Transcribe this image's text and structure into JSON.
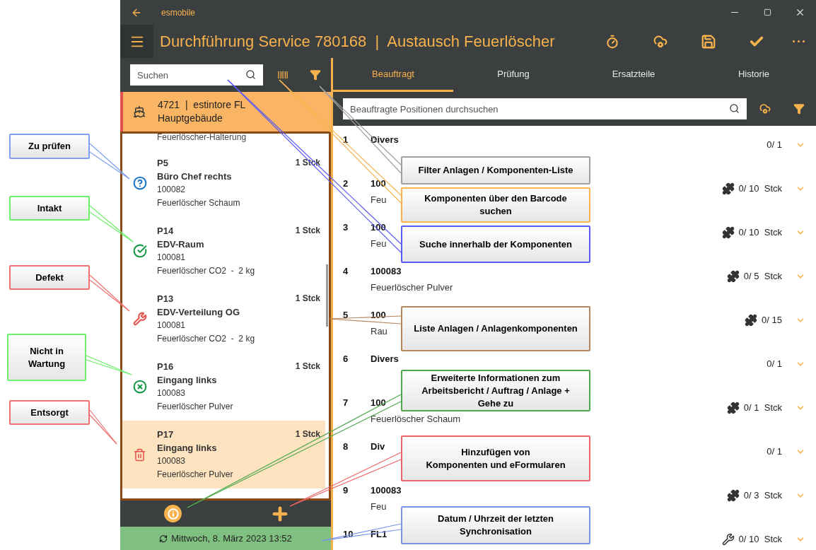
{
  "window": {
    "title": "esmobile"
  },
  "header": {
    "title": "Durchführung Service 780168  |  Austausch Feuerlöscher"
  },
  "left_panel": {
    "search": {
      "placeholder": "Suchen"
    },
    "selected_object": {
      "title": "4721  |  estintore FL",
      "subtitle": "Hauptgebäude"
    },
    "cut_item_text": "Feuerlöscher-Halterung",
    "items": [
      {
        "position": "P5",
        "name": "Büro Chef rechts",
        "number": "100082",
        "description": "Feuerlöscher Schaum",
        "quantity": "1 Stck",
        "kind": "check",
        "selected": false
      },
      {
        "position": "P14",
        "name": "EDV-Raum",
        "number": "100081",
        "description": "Feuerlöscher CO2  -  2 kg",
        "quantity": "1 Stck",
        "kind": "intact",
        "selected": false
      },
      {
        "position": "P13",
        "name": "EDV-Verteilung OG",
        "number": "100081",
        "description": "Feuerlöscher CO2  -  2 kg",
        "quantity": "1 Stck",
        "kind": "defect",
        "selected": false
      },
      {
        "position": "P16",
        "name": "Eingang links",
        "number": "100083",
        "description": "Feuerlöscher Pulver",
        "quantity": "1 Stck",
        "kind": "not_maintained",
        "selected": false
      },
      {
        "position": "P17",
        "name": "Eingang links",
        "number": "100083",
        "description": "Feuerlöscher Pulver",
        "quantity": "1 Stck",
        "kind": "disposed",
        "selected": true
      }
    ],
    "sync": "Mittwoch, 8. März 2023 13:52"
  },
  "tabs": [
    {
      "label": "Beauftragt",
      "selected": true
    },
    {
      "label": "Prüfung",
      "selected": false
    },
    {
      "label": "Ersatzteile",
      "selected": false
    },
    {
      "label": "Historie",
      "selected": false
    }
  ],
  "positions_search": {
    "placeholder": "Beauftragte Positionen durchsuchen"
  },
  "positions": [
    {
      "number": "1",
      "title": "Divers",
      "count": "0/ 1",
      "kind": "plain"
    },
    {
      "number": "2",
      "title": "100",
      "subtitle": "Feu",
      "count": "0/ 10  Stck",
      "kind": "component"
    },
    {
      "number": "3",
      "title": "100",
      "subtitle": "Feu",
      "count": "0/ 10  Stck",
      "kind": "component"
    },
    {
      "number": "4",
      "title": "100083",
      "subtitle": "Feuerlöscher Pulver",
      "count": "0/ 5  Stck",
      "kind": "component"
    },
    {
      "number": "5",
      "title": "100",
      "subtitle": "Rau",
      "count": "0/ 15",
      "kind": "component"
    },
    {
      "number": "6",
      "title": "Divers",
      "count": "0/ 1",
      "kind": "plain"
    },
    {
      "number": "7",
      "title": "100",
      "subtitle": "Feuerlöscher Schaum",
      "count": "0/ 1  Stck",
      "kind": "component"
    },
    {
      "number": "8",
      "title": "Div",
      "count": "0/ 1",
      "kind": "plain"
    },
    {
      "number": "9",
      "title": "100083",
      "subtitle": "Feu",
      "count": "0/ 3  Stck",
      "kind": "component"
    },
    {
      "number": "10",
      "title": "FL1",
      "count": "0/ 10  Stck",
      "kind": "tool"
    }
  ],
  "annotations": [
    {
      "text": "Zu prüfen",
      "color": "#7f9ff0"
    },
    {
      "text": "Intakt",
      "color": "#6cf06c"
    },
    {
      "text": "Defekt",
      "color": "#f07272"
    },
    {
      "text": "Nicht in\nWartung",
      "color": "#6cf06c"
    },
    {
      "text": "Entsorgt",
      "color": "#f07272"
    },
    {
      "text": "Filter Anlagen / Komponenten-Liste",
      "color": "#a0a0a0"
    },
    {
      "text": "Komponenten über den Barcode\nsuchen",
      "color": "#f7b34f"
    },
    {
      "text": "Suche innerhalb der Komponenten",
      "color": "#5a5af5"
    },
    {
      "text": "Liste Anlagen / Anlagenkomponenten",
      "color": "#b8865c"
    },
    {
      "text": "Erweiterte Informationen zum\nArbeitsbericht / Auftrag / Anlage +\nGehe zu",
      "color": "#4ea84e"
    },
    {
      "text": "Hinzufügen von\nKomponenten und eFormularen",
      "color": "#f06464"
    },
    {
      "text": "Datum / Uhrzeit der letzten\nSynchronisation",
      "color": "#7896e8"
    }
  ]
}
